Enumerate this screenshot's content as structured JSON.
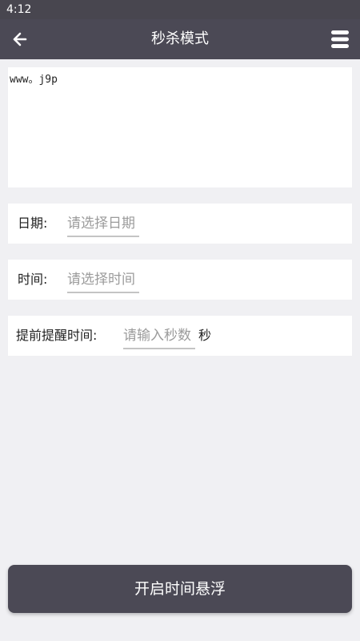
{
  "status_bar": {
    "time": "4:12"
  },
  "app_bar": {
    "title": "秒杀模式",
    "back_icon": "arrow-left-icon",
    "menu_icon": "hamburger-menu-icon",
    "background": "#4b4955"
  },
  "notes": {
    "value": "www。j9p"
  },
  "date_row": {
    "label": "日期:",
    "placeholder": "请选择日期"
  },
  "time_row": {
    "label": "时间:",
    "placeholder": "请选择时间"
  },
  "reminder_row": {
    "label": "提前提醒时间:",
    "placeholder": "请输入秒数",
    "suffix": "秒"
  },
  "float_button": {
    "label": "开启时间悬浮"
  }
}
